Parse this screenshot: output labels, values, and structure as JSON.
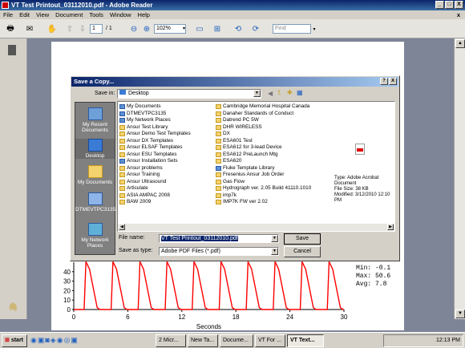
{
  "window": {
    "title": "VT Test Printout_03112010.pdf - Adobe Reader",
    "min": "_",
    "max": "□",
    "close": "X"
  },
  "menu": [
    "File",
    "Edit",
    "View",
    "Document",
    "Tools",
    "Window",
    "Help"
  ],
  "menu_close": "x",
  "toolbar": {
    "page_current": "1",
    "page_total": "/ 1",
    "zoom": "102%",
    "find_placeholder": "Find"
  },
  "document": {
    "chart_data": {
      "type": "line",
      "xlabel": "Seconds",
      "x_ticks": [
        "0",
        "6",
        "12",
        "18",
        "24",
        "30"
      ],
      "y_ticks": [
        "40",
        "30",
        "20",
        "10",
        "0"
      ],
      "xlim": [
        0,
        30
      ],
      "stats": [
        "Min: -0.1",
        "Max: 50.6",
        "Avg: 7.8"
      ],
      "series": [
        {
          "color": "#ff0000",
          "peaks_x": [
            1.5,
            4.5,
            7.5,
            10.5,
            13.5,
            16.5,
            19.5,
            22.5,
            25.5,
            28.5
          ],
          "peak_value": 50.6,
          "baseline": 0
        }
      ]
    }
  },
  "dialog": {
    "title": "Save a Copy...",
    "help": "?",
    "close": "X",
    "save_in_label": "Save in:",
    "save_in_value": "Desktop",
    "places": [
      "My Recent Documents",
      "Desktop",
      "My Documents",
      "DTMEVTPC3135",
      "My Network Places"
    ],
    "files_col1": [
      {
        "name": "My Documents",
        "kind": "special"
      },
      {
        "name": "DTMEVTPC3135",
        "kind": "special"
      },
      {
        "name": "My Network Places",
        "kind": "special"
      },
      {
        "name": "Ansur Test Library",
        "kind": "folder"
      },
      {
        "name": "Ansur Demo Test Templates",
        "kind": "folder"
      },
      {
        "name": "Ansur DX Templates",
        "kind": "folder"
      },
      {
        "name": "Ansur ELSAF Templates",
        "kind": "folder"
      },
      {
        "name": "Ansur ESU Templates",
        "kind": "folder"
      },
      {
        "name": "Ansur Installation Sets",
        "kind": "special"
      },
      {
        "name": "Ansur problems",
        "kind": "folder"
      },
      {
        "name": "Ansur Training",
        "kind": "folder"
      },
      {
        "name": "Ansur Ultrasound",
        "kind": "folder"
      },
      {
        "name": "Articulate",
        "kind": "folder"
      },
      {
        "name": "ASIA AMPAC 2008",
        "kind": "folder"
      },
      {
        "name": "BAW 2009",
        "kind": "folder"
      }
    ],
    "files_col2": [
      {
        "name": "Cambridge Memorial Hospital Canada",
        "kind": "folder"
      },
      {
        "name": "Danaher Standards of Conduct",
        "kind": "folder"
      },
      {
        "name": "Datrend PC 5W",
        "kind": "folder"
      },
      {
        "name": "DHR WIRELESS",
        "kind": "folder"
      },
      {
        "name": "DX",
        "kind": "folder"
      },
      {
        "name": "ESA601 Test",
        "kind": "folder"
      },
      {
        "name": "ESA612 for 3-lead Device",
        "kind": "folder"
      },
      {
        "name": "ESA612 PreLaunch Mtg",
        "kind": "folder"
      },
      {
        "name": "ESA620",
        "kind": "folder"
      },
      {
        "name": "Fluke Template Library",
        "kind": "special"
      },
      {
        "name": "Fresenius Ansur Job Order",
        "kind": "folder"
      },
      {
        "name": "Gas Flow",
        "kind": "folder"
      },
      {
        "name": "Hydrograph ver. 2.05 Build 41110.1010",
        "kind": "folder"
      },
      {
        "name": "imp7k",
        "kind": "folder"
      },
      {
        "name": "IMP7K FW ver 2.02",
        "kind": "folder"
      }
    ],
    "file_info": [
      "Type: Adobe Acrobat Document",
      "File Size: 38 KB",
      "Modified: 3/12/2010 12:10 PM"
    ],
    "file_name_label": "File name:",
    "file_name_value": "VT Test Printout_03112010.pdf",
    "save_type_label": "Save as type:",
    "save_type_value": "Adobe PDF Files (*.pdf)",
    "save_button": "Save",
    "cancel_button": "Cancel"
  },
  "taskbar": {
    "start": "start",
    "buttons": [
      "2 Micr...",
      "New Ta...",
      "Docume...",
      "VT For ...",
      "VT Text..."
    ],
    "clock": "12:13 PM"
  }
}
